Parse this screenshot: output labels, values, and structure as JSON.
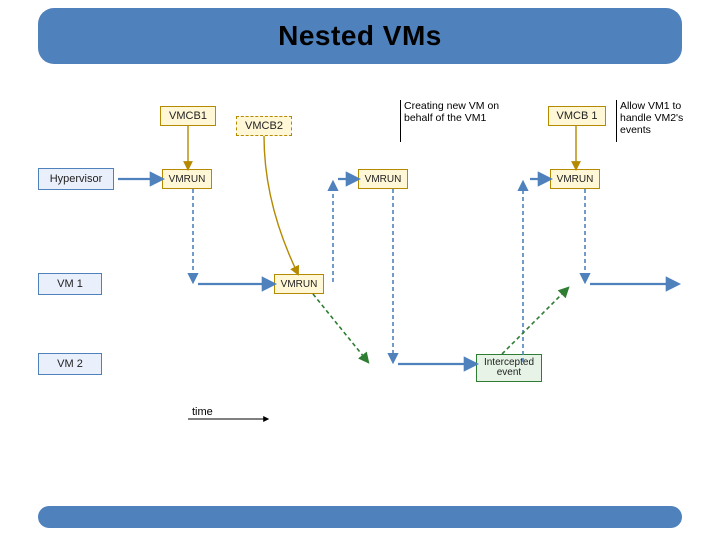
{
  "title": "Nested VMs",
  "labels": {
    "hypervisor": "Hypervisor",
    "vm1": "VM 1",
    "vm2": "VM 2",
    "vmcb1_a": "VMCB1",
    "vmcb2": "VMCB2",
    "vmcb1_b": "VMCB 1",
    "vmrun1": "VMRUN",
    "vmrun2": "VMRUN",
    "vmrun3": "VMRUN",
    "vmrun4": "VMRUN",
    "intercept": "Intercepted\nevent",
    "time": "time",
    "anno_create": "Creating new VM on behalf of the VM1",
    "anno_allow": "Allow VM1 to handle VM2's events"
  },
  "colors": {
    "blue_arrow": "#4f81bd",
    "blue_dash": "#4f81bd",
    "green_dash": "#2e7d32",
    "orange": "#b58900",
    "black": "#000"
  },
  "y": {
    "vmcb": 30,
    "hyp": 95,
    "vm1": 200,
    "vm2": 280
  },
  "timeline": {
    "start": 150,
    "end": 640
  }
}
